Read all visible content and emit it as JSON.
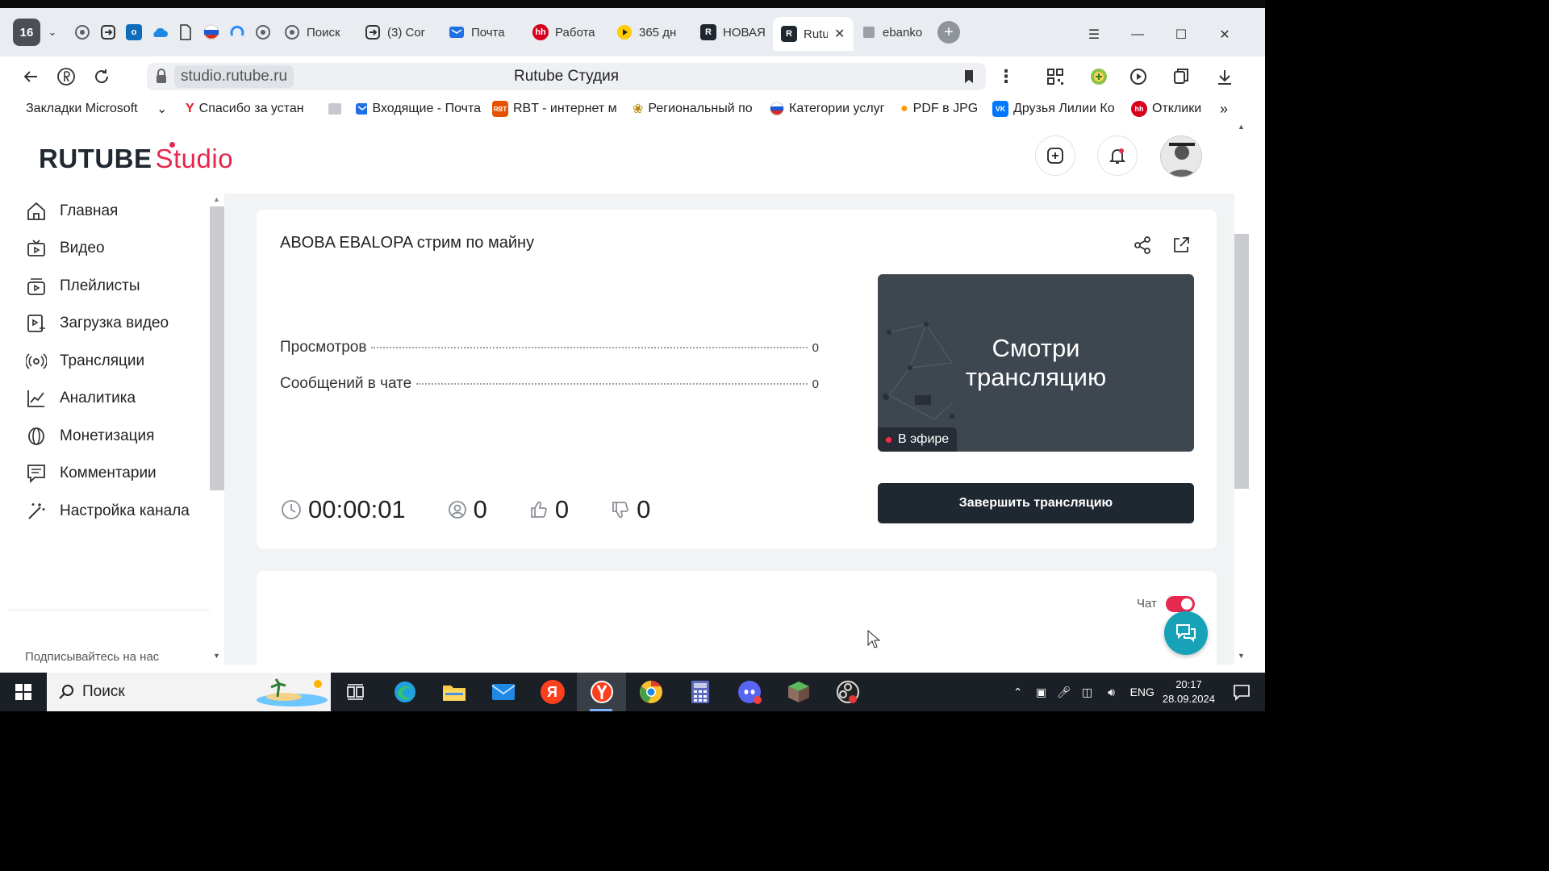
{
  "browser": {
    "tab_count": "16",
    "tabs": [
      {
        "title": "Поиск",
        "fav": "circle-icon",
        "color": "#5b6168"
      },
      {
        "title": "(3) Cor",
        "fav": "arrows-icon",
        "color": "#555"
      },
      {
        "title": "Почта",
        "fav": "mail-icon",
        "color": "#1f6fe5"
      },
      {
        "title": "Работа",
        "fav": "hh-icon",
        "color": "#d6001c"
      },
      {
        "title": "365 дн",
        "fav": "play-icon",
        "color": "#ffcc00"
      },
      {
        "title": "НОВАЯ",
        "fav": "r-icon",
        "color": "#1f2731"
      },
      {
        "title": "Rutube",
        "fav": "r-icon",
        "color": "#1f2731",
        "active": true
      },
      {
        "title": "ebanko",
        "fav": "doc-icon",
        "color": "#888"
      }
    ],
    "url": "studio.rutube.ru",
    "page_title": "Rutube Студия",
    "bookmarks": [
      {
        "label": "Закладки Microsoft",
        "icon": "folder-icon"
      },
      {
        "label": "Спасибо за устан",
        "icon": "yandex-icon"
      },
      {
        "label": "",
        "icon": "image-icon"
      },
      {
        "label": "Входящие - Почта",
        "icon": "mail-icon"
      },
      {
        "label": "RBT - интернет м",
        "icon": "rbt-icon"
      },
      {
        "label": "Региональный по",
        "icon": "emblem-icon"
      },
      {
        "label": "Категории услуг",
        "icon": "flag-icon"
      },
      {
        "label": "PDF в JPG",
        "icon": "pdf-icon"
      },
      {
        "label": "Друзья Лилии Ко",
        "icon": "vk-icon"
      },
      {
        "label": "Отклики",
        "icon": "hh-icon"
      }
    ]
  },
  "studio": {
    "logo_main": "RUTUBE",
    "logo_sub": "Studio",
    "nav": [
      {
        "label": "Главная",
        "icon": "home-icon"
      },
      {
        "label": "Видео",
        "icon": "video-icon"
      },
      {
        "label": "Плейлисты",
        "icon": "playlist-icon"
      },
      {
        "label": "Загрузка видео",
        "icon": "upload-icon"
      },
      {
        "label": "Трансляции",
        "icon": "broadcast-icon"
      },
      {
        "label": "Аналитика",
        "icon": "analytics-icon"
      },
      {
        "label": "Монетизация",
        "icon": "coin-icon"
      },
      {
        "label": "Комментарии",
        "icon": "comments-icon"
      },
      {
        "label": "Настройка канала",
        "icon": "wand-icon"
      }
    ],
    "follow_label": "Подписывайтесь на нас",
    "stream": {
      "title": "ABOBA EBALOPA стрим по майну",
      "views_label": "Просмотров",
      "views_value": "0",
      "chat_label": "Сообщений в чате",
      "chat_value": "0",
      "preview_line1": "Смотри",
      "preview_line2": "трансляцию",
      "live_badge": "В эфире",
      "end_button": "Завершить трансляцию",
      "duration": "00:00:01",
      "viewers": "0",
      "likes": "0",
      "dislikes": "0"
    },
    "chat_toggle_label": "Чат",
    "chat_enabled": true,
    "accent": "#e5284e"
  },
  "taskbar": {
    "search_placeholder": "Поиск",
    "lang": "ENG",
    "time": "20:17",
    "date": "28.09.2024"
  }
}
